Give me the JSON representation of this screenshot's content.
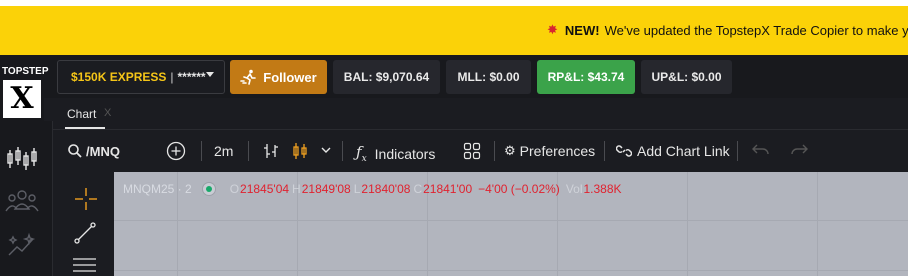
{
  "banner": {
    "new_label": "NEW!",
    "message": "We've updated the TopstepX Trade Copier to make y",
    "icon": "sparkle-icon",
    "background": "#fbd208"
  },
  "logo": {
    "text": "TOPSTEP",
    "mark": "X"
  },
  "account": {
    "name": "$150K EXPRESS",
    "separator": "|",
    "masked": "******"
  },
  "follower": {
    "label": "Follower"
  },
  "stats": {
    "bal": "BAL: $9,070.64",
    "mll": "MLL: $0.00",
    "rpl": "RP&L: $43.74",
    "upl": "UP&L: $0.00"
  },
  "tab": {
    "label": "Chart",
    "close": "X"
  },
  "toolbar": {
    "symbol": "/MNQ",
    "interval": "2m",
    "indicators": "Indicators",
    "preferences": "Preferences",
    "add_chart_link": "Add Chart Link"
  },
  "legend": {
    "symbol": "MNQM25 · 2",
    "o_key": "O",
    "o_val": "21845'04",
    "h_key": "H",
    "h_val": "21849'08",
    "l_key": "L",
    "l_val": "21840'08",
    "c_key": "C",
    "c_val": "21841'00",
    "change": "−4'00 (−0.02%)",
    "vol_key": "Vol",
    "vol_val": "1.388K"
  },
  "colors": {
    "accent": "#f5c518",
    "follower": "#c27a15",
    "profit": "#3ba34a",
    "loss": "#e0222f",
    "chart_bg": "#b2b5be"
  }
}
